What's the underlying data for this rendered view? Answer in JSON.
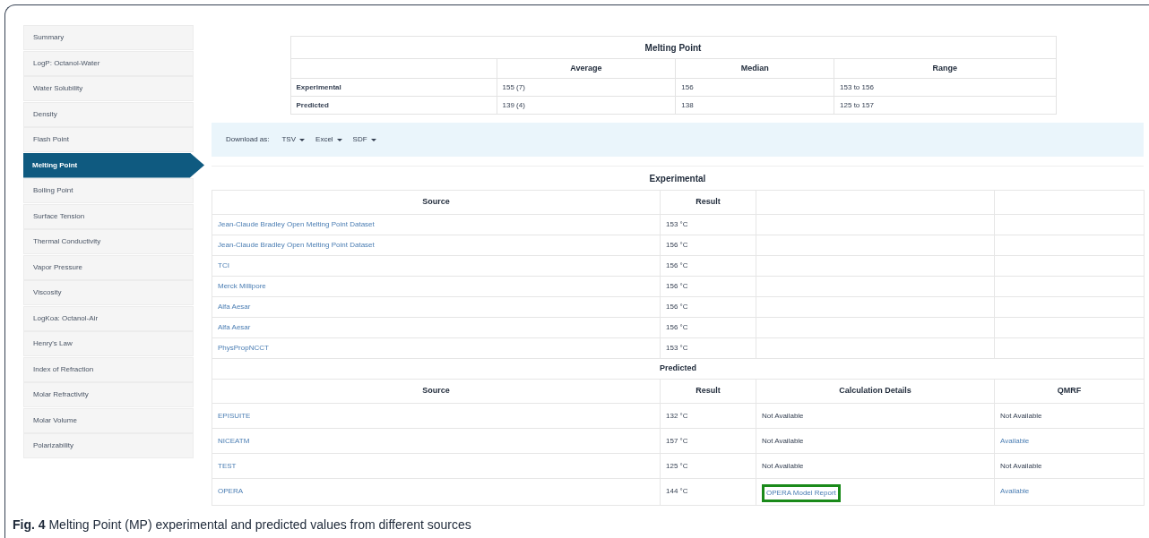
{
  "sidebar": {
    "items": [
      {
        "label": "Summary",
        "selected": false
      },
      {
        "label": "LogP: Octanol-Water",
        "selected": false
      },
      {
        "label": "Water Solubility",
        "selected": false
      },
      {
        "label": "Density",
        "selected": false
      },
      {
        "label": "Flash Point",
        "selected": false
      },
      {
        "label": "Melting Point",
        "selected": true
      },
      {
        "label": "Boiling Point",
        "selected": false
      },
      {
        "label": "Surface Tension",
        "selected": false
      },
      {
        "label": "Thermal Conductivity",
        "selected": false
      },
      {
        "label": "Vapor Pressure",
        "selected": false
      },
      {
        "label": "Viscosity",
        "selected": false
      },
      {
        "label": "LogKoa: Octanol-Air",
        "selected": false
      },
      {
        "label": "Henry's Law",
        "selected": false
      },
      {
        "label": "Index of Refraction",
        "selected": false
      },
      {
        "label": "Molar Refractivity",
        "selected": false
      },
      {
        "label": "Molar Volume",
        "selected": false
      },
      {
        "label": "Polarizability",
        "selected": false
      }
    ]
  },
  "summary_table": {
    "title": "Melting Point",
    "columns": [
      "Average",
      "Median",
      "Range"
    ],
    "rows": [
      {
        "label": "Experimental",
        "cells": [
          "155 (7)",
          "156",
          "153 to 156"
        ]
      },
      {
        "label": "Predicted",
        "cells": [
          "139 (4)",
          "138",
          "125 to 157"
        ]
      }
    ]
  },
  "download": {
    "label": "Download as:",
    "options": [
      "TSV",
      "Excel",
      "SDF"
    ]
  },
  "experimental": {
    "title": "Experimental",
    "columns": [
      "Source",
      "Result"
    ],
    "rows": [
      {
        "source": "Jean-Claude Bradley Open Melting Point Dataset",
        "result": "153 °C"
      },
      {
        "source": "Jean-Claude Bradley Open Melting Point Dataset",
        "result": "156 °C"
      },
      {
        "source": "TCI",
        "result": "156 °C"
      },
      {
        "source": "Merck Millipore",
        "result": "156 °C"
      },
      {
        "source": "Alfa Aesar",
        "result": "156 °C"
      },
      {
        "source": "Alfa Aesar",
        "result": "156 °C"
      },
      {
        "source": "PhysPropNCCT",
        "result": "153 °C"
      }
    ]
  },
  "predicted": {
    "title": "Predicted",
    "columns": [
      "Source",
      "Result",
      "Calculation Details",
      "QMRF"
    ],
    "rows": [
      {
        "source": "EPISUITE",
        "result": "132 °C",
        "details": {
          "text": "Not Available",
          "kind": "plain",
          "highlighted": false
        },
        "qmrf": {
          "text": "Not Available",
          "kind": "plain"
        }
      },
      {
        "source": "NICEATM",
        "result": "157 °C",
        "details": {
          "text": "Not Available",
          "kind": "plain",
          "highlighted": false
        },
        "qmrf": {
          "text": "Available",
          "kind": "link"
        }
      },
      {
        "source": "TEST",
        "result": "125 °C",
        "details": {
          "text": "Not Available",
          "kind": "plain",
          "highlighted": false
        },
        "qmrf": {
          "text": "Not Available",
          "kind": "plain"
        }
      },
      {
        "source": "OPERA",
        "result": "144 °C",
        "details": {
          "text": "OPERA Model Report",
          "kind": "link",
          "highlighted": true
        },
        "qmrf": {
          "text": "Available",
          "kind": "link"
        }
      }
    ]
  },
  "caption": "**Fig. 4** Melting Point (MP) experimental and predicted values from different sources"
}
